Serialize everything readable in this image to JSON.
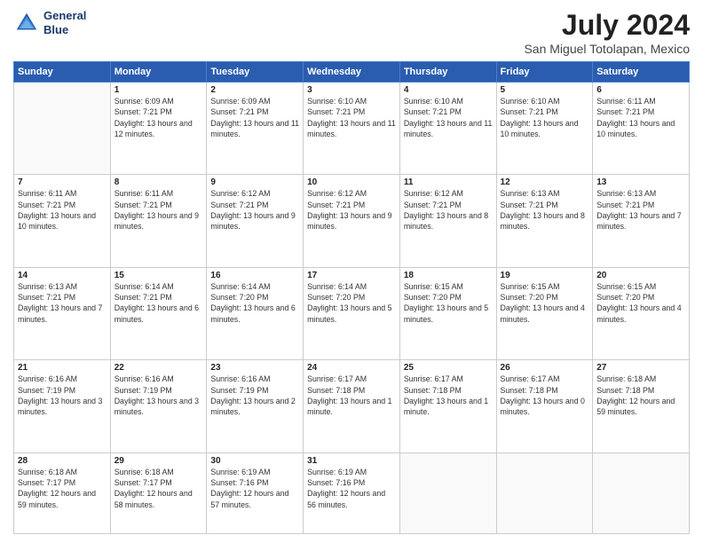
{
  "logo": {
    "line1": "General",
    "line2": "Blue"
  },
  "title": "July 2024",
  "subtitle": "San Miguel Totolapan, Mexico",
  "days_of_week": [
    "Sunday",
    "Monday",
    "Tuesday",
    "Wednesday",
    "Thursday",
    "Friday",
    "Saturday"
  ],
  "weeks": [
    [
      {
        "day": "",
        "empty": true
      },
      {
        "day": "1",
        "sunrise": "6:09 AM",
        "sunset": "7:21 PM",
        "daylight": "13 hours and 12 minutes."
      },
      {
        "day": "2",
        "sunrise": "6:09 AM",
        "sunset": "7:21 PM",
        "daylight": "13 hours and 11 minutes."
      },
      {
        "day": "3",
        "sunrise": "6:10 AM",
        "sunset": "7:21 PM",
        "daylight": "13 hours and 11 minutes."
      },
      {
        "day": "4",
        "sunrise": "6:10 AM",
        "sunset": "7:21 PM",
        "daylight": "13 hours and 11 minutes."
      },
      {
        "day": "5",
        "sunrise": "6:10 AM",
        "sunset": "7:21 PM",
        "daylight": "13 hours and 10 minutes."
      },
      {
        "day": "6",
        "sunrise": "6:11 AM",
        "sunset": "7:21 PM",
        "daylight": "13 hours and 10 minutes."
      }
    ],
    [
      {
        "day": "7",
        "sunrise": "6:11 AM",
        "sunset": "7:21 PM",
        "daylight": "13 hours and 10 minutes."
      },
      {
        "day": "8",
        "sunrise": "6:11 AM",
        "sunset": "7:21 PM",
        "daylight": "13 hours and 9 minutes."
      },
      {
        "day": "9",
        "sunrise": "6:12 AM",
        "sunset": "7:21 PM",
        "daylight": "13 hours and 9 minutes."
      },
      {
        "day": "10",
        "sunrise": "6:12 AM",
        "sunset": "7:21 PM",
        "daylight": "13 hours and 9 minutes."
      },
      {
        "day": "11",
        "sunrise": "6:12 AM",
        "sunset": "7:21 PM",
        "daylight": "13 hours and 8 minutes."
      },
      {
        "day": "12",
        "sunrise": "6:13 AM",
        "sunset": "7:21 PM",
        "daylight": "13 hours and 8 minutes."
      },
      {
        "day": "13",
        "sunrise": "6:13 AM",
        "sunset": "7:21 PM",
        "daylight": "13 hours and 7 minutes."
      }
    ],
    [
      {
        "day": "14",
        "sunrise": "6:13 AM",
        "sunset": "7:21 PM",
        "daylight": "13 hours and 7 minutes."
      },
      {
        "day": "15",
        "sunrise": "6:14 AM",
        "sunset": "7:21 PM",
        "daylight": "13 hours and 6 minutes."
      },
      {
        "day": "16",
        "sunrise": "6:14 AM",
        "sunset": "7:20 PM",
        "daylight": "13 hours and 6 minutes."
      },
      {
        "day": "17",
        "sunrise": "6:14 AM",
        "sunset": "7:20 PM",
        "daylight": "13 hours and 5 minutes."
      },
      {
        "day": "18",
        "sunrise": "6:15 AM",
        "sunset": "7:20 PM",
        "daylight": "13 hours and 5 minutes."
      },
      {
        "day": "19",
        "sunrise": "6:15 AM",
        "sunset": "7:20 PM",
        "daylight": "13 hours and 4 minutes."
      },
      {
        "day": "20",
        "sunrise": "6:15 AM",
        "sunset": "7:20 PM",
        "daylight": "13 hours and 4 minutes."
      }
    ],
    [
      {
        "day": "21",
        "sunrise": "6:16 AM",
        "sunset": "7:19 PM",
        "daylight": "13 hours and 3 minutes."
      },
      {
        "day": "22",
        "sunrise": "6:16 AM",
        "sunset": "7:19 PM",
        "daylight": "13 hours and 3 minutes."
      },
      {
        "day": "23",
        "sunrise": "6:16 AM",
        "sunset": "7:19 PM",
        "daylight": "13 hours and 2 minutes."
      },
      {
        "day": "24",
        "sunrise": "6:17 AM",
        "sunset": "7:18 PM",
        "daylight": "13 hours and 1 minute."
      },
      {
        "day": "25",
        "sunrise": "6:17 AM",
        "sunset": "7:18 PM",
        "daylight": "13 hours and 1 minute."
      },
      {
        "day": "26",
        "sunrise": "6:17 AM",
        "sunset": "7:18 PM",
        "daylight": "13 hours and 0 minutes."
      },
      {
        "day": "27",
        "sunrise": "6:18 AM",
        "sunset": "7:18 PM",
        "daylight": "12 hours and 59 minutes."
      }
    ],
    [
      {
        "day": "28",
        "sunrise": "6:18 AM",
        "sunset": "7:17 PM",
        "daylight": "12 hours and 59 minutes."
      },
      {
        "day": "29",
        "sunrise": "6:18 AM",
        "sunset": "7:17 PM",
        "daylight": "12 hours and 58 minutes."
      },
      {
        "day": "30",
        "sunrise": "6:19 AM",
        "sunset": "7:16 PM",
        "daylight": "12 hours and 57 minutes."
      },
      {
        "day": "31",
        "sunrise": "6:19 AM",
        "sunset": "7:16 PM",
        "daylight": "12 hours and 56 minutes."
      },
      {
        "day": "",
        "empty": true
      },
      {
        "day": "",
        "empty": true
      },
      {
        "day": "",
        "empty": true
      }
    ]
  ]
}
